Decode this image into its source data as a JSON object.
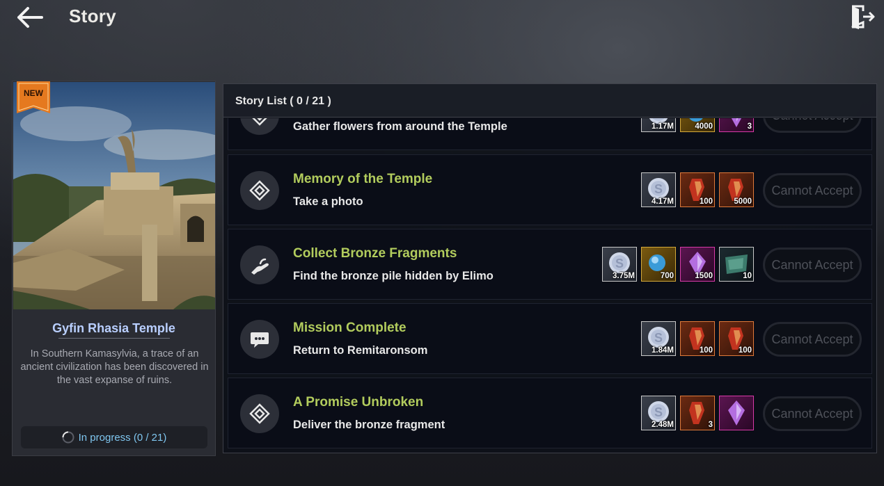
{
  "header": {
    "title": "Story",
    "back_icon": "back-arrow-icon",
    "exit_icon": "exit-door-icon"
  },
  "card": {
    "badge": "NEW",
    "name": "Gyfin Rhasia Temple",
    "description": "In Southern Kamasylvia, a trace of an ancient civilization has been discovered in the vast expanse of ruins.",
    "progress": "In progress (0 / 21)"
  },
  "list": {
    "title": "Story List ( 0 / 21 )",
    "items": [
      {
        "name": "",
        "desc": "Gather flowers from around the Temple",
        "icon": "diamond-icon",
        "rewards": [
          {
            "type": "silver",
            "qty": "1.17M"
          },
          {
            "type": "gold",
            "qty": "4000"
          },
          {
            "type": "purple",
            "qty": "3"
          }
        ],
        "button": "Cannot Accept"
      },
      {
        "name": "Memory of the Temple",
        "desc": "Take a photo",
        "icon": "diamond-icon",
        "rewards": [
          {
            "type": "silver",
            "qty": "4.17M"
          },
          {
            "type": "orange",
            "qty": "100"
          },
          {
            "type": "orange",
            "qty": "5000"
          }
        ],
        "button": "Cannot Accept"
      },
      {
        "name": "Collect Bronze Fragments",
        "desc": "Find the bronze pile hidden by Elimo",
        "icon": "hand-icon",
        "rewards": [
          {
            "type": "silver",
            "qty": "3.75M"
          },
          {
            "type": "gold",
            "qty": "700"
          },
          {
            "type": "purple",
            "qty": "1500"
          },
          {
            "type": "teal",
            "qty": "10"
          }
        ],
        "button": "Cannot Accept"
      },
      {
        "name": "Mission Complete",
        "desc": "Return to Remitaronsom",
        "icon": "chat-bubble-icon",
        "rewards": [
          {
            "type": "silver",
            "qty": "1.84M"
          },
          {
            "type": "orange",
            "qty": "100"
          },
          {
            "type": "orange",
            "qty": "100"
          }
        ],
        "button": "Cannot Accept"
      },
      {
        "name": "A Promise Unbroken",
        "desc": "Deliver the bronze fragment",
        "icon": "diamond-icon",
        "rewards": [
          {
            "type": "silver",
            "qty": "2.48M"
          },
          {
            "type": "orange",
            "qty": "3"
          },
          {
            "type": "purple",
            "qty": ""
          }
        ],
        "button": "Cannot Accept"
      }
    ]
  }
}
